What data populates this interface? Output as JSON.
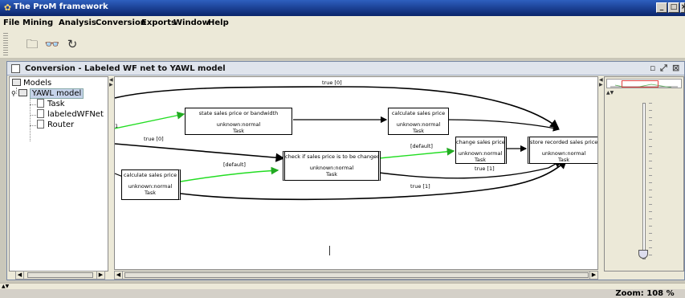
{
  "app": {
    "title": "The ProM framework"
  },
  "menu": [
    "File",
    "Mining",
    "Analysis",
    "Conversion",
    "Exports",
    "Window",
    "Help"
  ],
  "toolbar": {
    "buttons": [
      "open-folder-icon",
      "binoculars-icon",
      "refresh-icon"
    ]
  },
  "internal_frame": {
    "title": "Conversion - Labeled WF net to YAWL model"
  },
  "tree": {
    "root": "Models",
    "model": "YAWL model",
    "children": [
      "Task",
      "labeledWFNet",
      "Router"
    ]
  },
  "graph": {
    "tasks": [
      {
        "name": "state sales price or bandwidth",
        "status": "unknown:normal",
        "type": "Task"
      },
      {
        "name": "calculate sales price",
        "status": "unknown:normal",
        "type": "Task"
      },
      {
        "name": "check if sales price is to be changed",
        "status": "unknown:normal",
        "type": "Task"
      },
      {
        "name": "change sales price",
        "status": "unknown:normal",
        "type": "Task"
      },
      {
        "name": "store recorded sales price",
        "status": "unknown:normal",
        "type": "Task"
      },
      {
        "name": "calculate sales price",
        "status": "unknown:normal",
        "type": "Task"
      }
    ],
    "edge_labels": [
      "true [0]",
      "true [0]",
      "[default]",
      "[default]",
      "true [1]",
      "true [1]",
      "1"
    ]
  },
  "zoom": {
    "label": "Zoom: 108 %",
    "percent": 108
  },
  "colors": {
    "titlebar": "#0a246a",
    "green_edge": "#22dd22",
    "black_edge": "#000000"
  }
}
